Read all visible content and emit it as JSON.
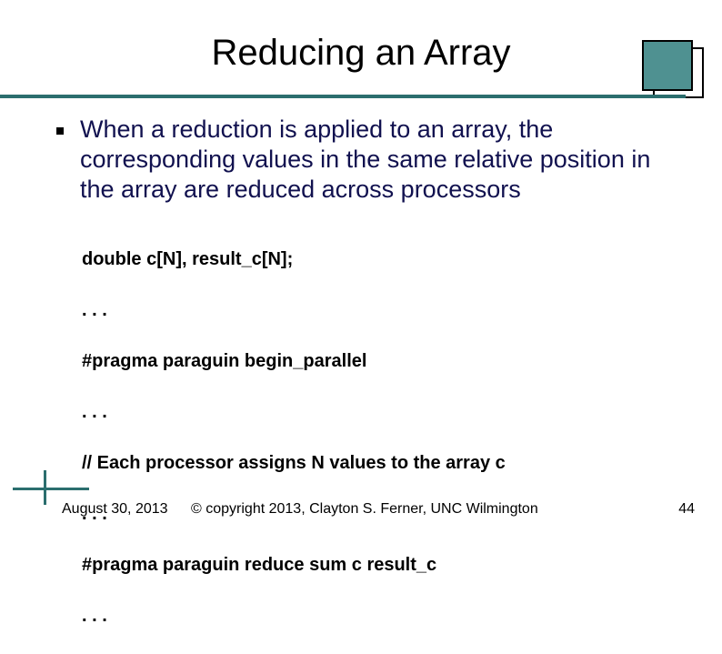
{
  "title": "Reducing an Array",
  "bullet": "When a reduction is applied to an array, the corresponding values in the same relative position in the array are reduced across processors",
  "code": {
    "l1": "double c[N], result_c[N];",
    "l2": ". . .",
    "l3": "#pragma paraguin begin_parallel",
    "l4": ". . .",
    "l5": "// Each processor assigns N values to the array c",
    "l6": ". . .",
    "l7": "#pragma paraguin reduce sum c result_c",
    "l8": ". . ."
  },
  "footer": {
    "date": "August 30, 2013",
    "copyright": "© copyright 2013, Clayton S. Ferner, UNC Wilmington",
    "page": "44"
  },
  "colors": {
    "accent": "#2b6e6e",
    "text_body": "#11114f"
  }
}
